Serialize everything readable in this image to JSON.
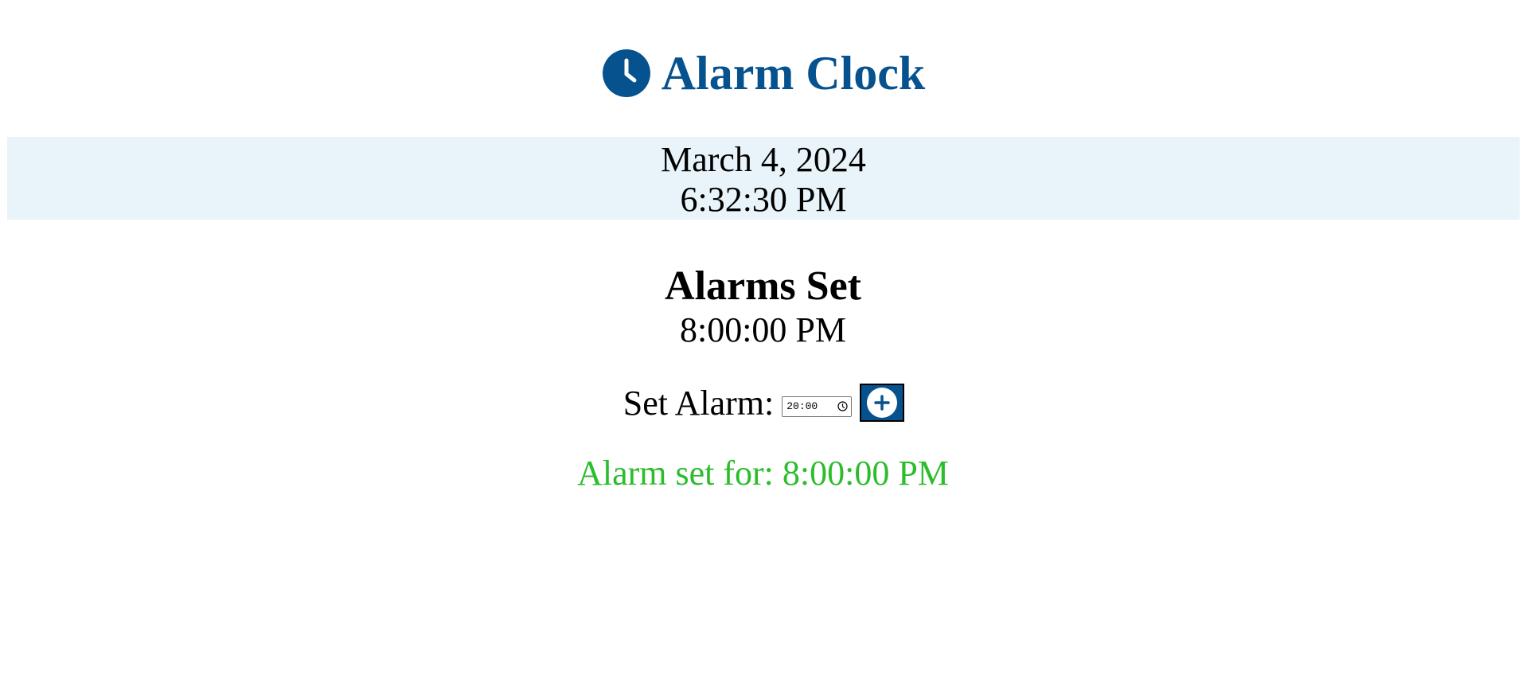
{
  "header": {
    "title": "Alarm Clock",
    "icon": "clock-icon",
    "accent_color": "#06528f"
  },
  "current": {
    "date": "March 4, 2024",
    "time": "6:32:30 PM",
    "band_color": "#e8f4f9"
  },
  "alarms": {
    "heading": "Alarms Set",
    "items": [
      "8:00:00 PM"
    ]
  },
  "set_alarm": {
    "label": "Set Alarm:",
    "input_value": "20:00",
    "input_icon": "clock-icon",
    "add_button_icon": "plus-circle-icon"
  },
  "status": {
    "message": "Alarm set for: 8:00:00 PM",
    "color": "#2bbd2b"
  }
}
